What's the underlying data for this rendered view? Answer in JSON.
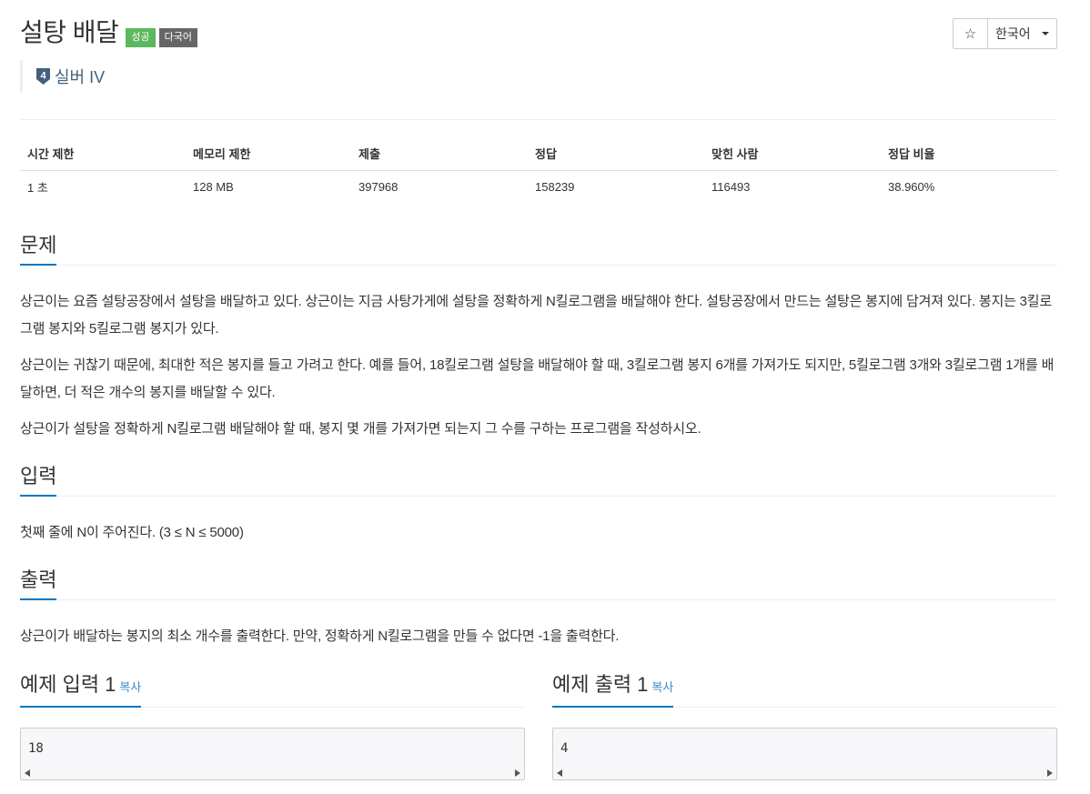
{
  "problem": {
    "title": "설탕 배달",
    "badges": {
      "success": "성공",
      "multilang": "다국어"
    },
    "tier": {
      "level": "4",
      "label": "실버 IV"
    }
  },
  "toolbar": {
    "star_icon": "star-icon",
    "language": "한국어"
  },
  "stats": {
    "headers": [
      "시간 제한",
      "메모리 제한",
      "제출",
      "정답",
      "맞힌 사람",
      "정답 비율"
    ],
    "values": [
      "1 초",
      "128 MB",
      "397968",
      "158239",
      "116493",
      "38.960%"
    ]
  },
  "sections": {
    "description": {
      "heading": "문제",
      "paragraphs": [
        "상근이는 요즘 설탕공장에서 설탕을 배달하고 있다. 상근이는 지금 사탕가게에 설탕을 정확하게 N킬로그램을 배달해야 한다. 설탕공장에서 만드는 설탕은 봉지에 담겨져 있다. 봉지는 3킬로그램 봉지와 5킬로그램 봉지가 있다.",
        "상근이는 귀찮기 때문에, 최대한 적은 봉지를 들고 가려고 한다. 예를 들어, 18킬로그램 설탕을 배달해야 할 때, 3킬로그램 봉지 6개를 가져가도 되지만, 5킬로그램 3개와 3킬로그램 1개를 배달하면, 더 적은 개수의 봉지를 배달할 수 있다.",
        "상근이가 설탕을 정확하게 N킬로그램 배달해야 할 때, 봉지 몇 개를 가져가면 되는지 그 수를 구하는 프로그램을 작성하시오."
      ]
    },
    "input": {
      "heading": "입력",
      "text": "첫째 줄에 N이 주어진다. (3 ≤ N ≤ 5000)"
    },
    "output": {
      "heading": "출력",
      "text": "상근이가 배달하는 봉지의 최소 개수를 출력한다. 만약, 정확하게 N킬로그램을 만들 수 없다면 -1을 출력한다."
    }
  },
  "samples": {
    "input": {
      "heading": "예제 입력 1",
      "copy_label": "복사",
      "value": "18"
    },
    "output": {
      "heading": "예제 출력 1",
      "copy_label": "복사",
      "value": "4"
    }
  },
  "colors": {
    "accent": "#0076c0",
    "success": "#5cb85c",
    "multilang": "#666666",
    "tier": "#435f7a",
    "link": "#428bca"
  }
}
